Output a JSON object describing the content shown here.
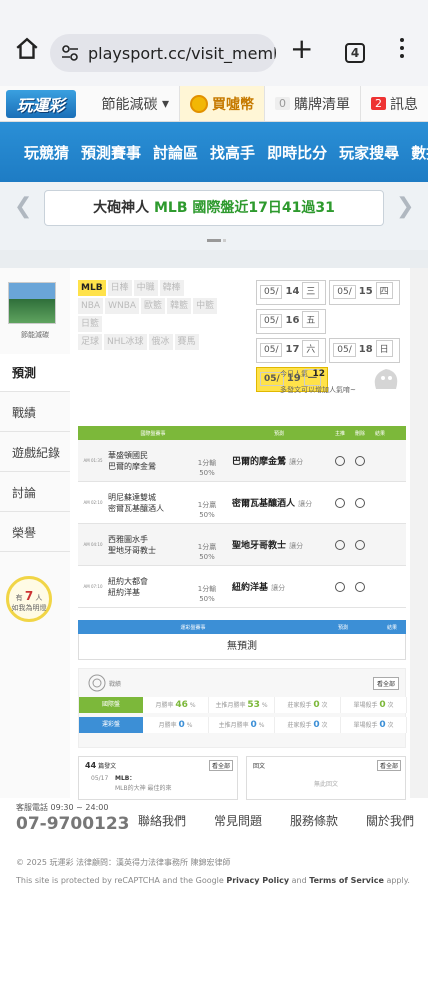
{
  "browser": {
    "url": "playsport.cc/visit_membe",
    "tab_count": "4"
  },
  "topbar": {
    "logo": "玩運彩",
    "eco": "節能減碳",
    "buy": "買噓幣",
    "cart_count": "0",
    "cart": "購牌清單",
    "msg_count": "2",
    "msg": "訊息"
  },
  "nav": [
    "玩競猜",
    "預測賽事",
    "討論區",
    "找高手",
    "即時比分",
    "玩家搜尋",
    "數據"
  ],
  "banner": {
    "prefix": "大砲神人",
    "league": "MLB",
    "suffix": "國際盤近17日41過31"
  },
  "user": {
    "name": "節能減碳"
  },
  "side_tabs": [
    "預測",
    "戰績",
    "遊戲紀錄",
    "討論",
    "榮譽"
  ],
  "bulb": {
    "line1": "有",
    "count": "7",
    "unit": "人",
    "line2": "如我為明燈"
  },
  "sports": [
    [
      "MLB",
      "日棒",
      "中職",
      "韓棒"
    ],
    [
      "NBA",
      "WNBA",
      "歐籃",
      "韓籃",
      "中籃"
    ],
    [
      "日籃"
    ],
    [
      "足球",
      "NHL冰球",
      "俄冰",
      "賽馬"
    ]
  ],
  "dates": [
    [
      {
        "d": "05/",
        "n": "14",
        "w": "三"
      },
      {
        "d": "05/",
        "n": "15",
        "w": "四"
      },
      {
        "d": "05/",
        "n": "16",
        "w": "五"
      }
    ],
    [
      {
        "d": "05/",
        "n": "17",
        "w": "六"
      },
      {
        "d": "05/",
        "n": "18",
        "w": "日"
      },
      {
        "d": "05/",
        "n": "19",
        "w": "一"
      }
    ]
  ],
  "popularity": {
    "label": "今日人氣",
    "value": "12",
    "hint": "多發文可以增加人氣唷~"
  },
  "table1": {
    "headers": [
      "國際盤賽事",
      "預測",
      "主推",
      "刪除",
      "結果"
    ],
    "rows": [
      {
        "time": "AM 01:35",
        "t1": "華盛頓國民",
        "t2": "巴爾的摩金鶯",
        "odds": "1分輸",
        "pct": "50%",
        "pick": "巴爾的摩金鶯",
        "kind": "讓分"
      },
      {
        "time": "AM 02:10",
        "t1": "明尼蘇達雙城",
        "t2": "密爾瓦基釀酒人",
        "odds": "1分贏",
        "pct": "50%",
        "pick": "密爾瓦基釀酒人",
        "kind": "讓分"
      },
      {
        "time": "AM 04:10",
        "t1": "西雅圖水手",
        "t2": "聖地牙哥教士",
        "odds": "1分贏",
        "pct": "50%",
        "pick": "聖地牙哥教士",
        "kind": "讓分"
      },
      {
        "time": "AM 07:10",
        "t1": "紐約大都會",
        "t2": "紐約洋基",
        "odds": "1分輸",
        "pct": "50%",
        "pick": "紐約洋基",
        "kind": "讓分"
      }
    ]
  },
  "table2": {
    "headers": [
      "運彩盤賽事",
      "預測",
      "結果"
    ],
    "empty": "無預測"
  },
  "record": {
    "title": "戰績",
    "all": "看全部",
    "rows": [
      {
        "tag": "國際盤",
        "c1": "月勝率",
        "v1": "46",
        "c2": "主推月勝率",
        "v2": "53",
        "c3": "莊家殺手",
        "v3": "0",
        "c4": "單場殺手",
        "v4": "0"
      },
      {
        "tag": "運彩盤",
        "c1": "月勝率",
        "v1": "0",
        "c2": "主推月勝率",
        "v2": "0",
        "c3": "莊家殺手",
        "v3": "0",
        "c4": "單場殺手",
        "v4": "0"
      }
    ]
  },
  "feeds": {
    "posts_count": "44",
    "posts_label": "篇發文",
    "all": "看全部",
    "post_date": "05/17",
    "post_title": "MLB：",
    "post_sub": "MLB的大神 最佳的來",
    "reply_label": "回文",
    "no_reply": "無此回文"
  },
  "footer": {
    "tel_label": "客服電話 09:30 ~ 24:00",
    "tel": "07-9700123",
    "links": [
      "聯絡我們",
      "常見問題",
      "服務條款",
      "關於我們"
    ],
    "copyright": "© 2025 玩運彩 法律顧問：漢英得力法律事務所 陳錦宏律師",
    "recaptcha_pre": "This site is protected by reCAPTCHA and the Google ",
    "privacy": "Privacy Policy",
    "and": " and ",
    "terms": "Terms of Service",
    "post": " apply."
  },
  "colors": {
    "nav": "#1e7cc4",
    "green_header": "#7cb83a",
    "blue_header": "#3c8fd6",
    "highlight": "#ffe24a"
  }
}
